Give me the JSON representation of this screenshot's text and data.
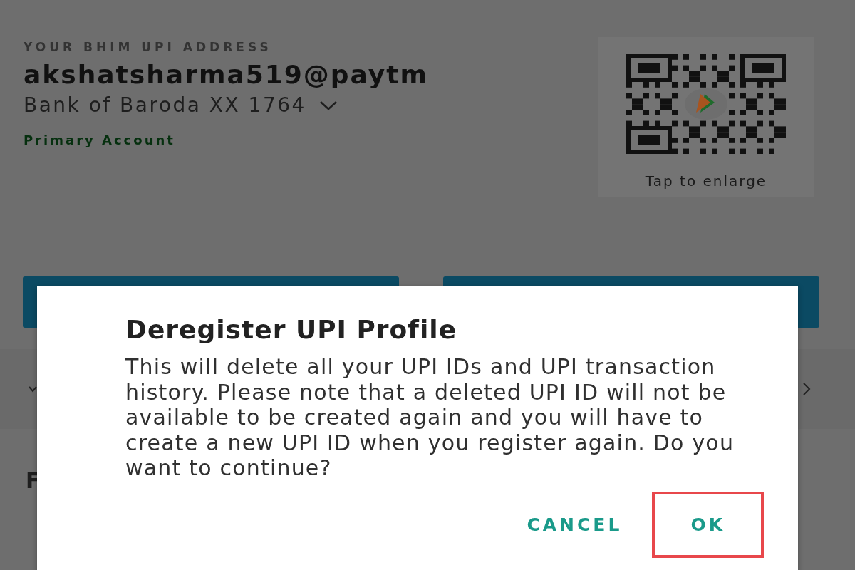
{
  "header": {
    "label": "YOUR BHIM UPI ADDRESS",
    "upi_id": "akshatsharma519@paytm",
    "bank_account": "Bank of Baroda XX 1764",
    "account_tag": "Primary Account"
  },
  "qr_card": {
    "caption": "Tap to enlarge"
  },
  "list_text": "F",
  "dialog": {
    "title": "Deregister UPI Profile",
    "message": "This will delete all your UPI IDs and UPI transaction history. Please note that a deleted UPI ID will not be available to be created again and you will have to create a new UPI ID when you register again. Do you want to continue?",
    "buttons": [
      {
        "label": "CANCEL",
        "highlighted": false
      },
      {
        "label": "OK",
        "highlighted": true
      }
    ]
  }
}
